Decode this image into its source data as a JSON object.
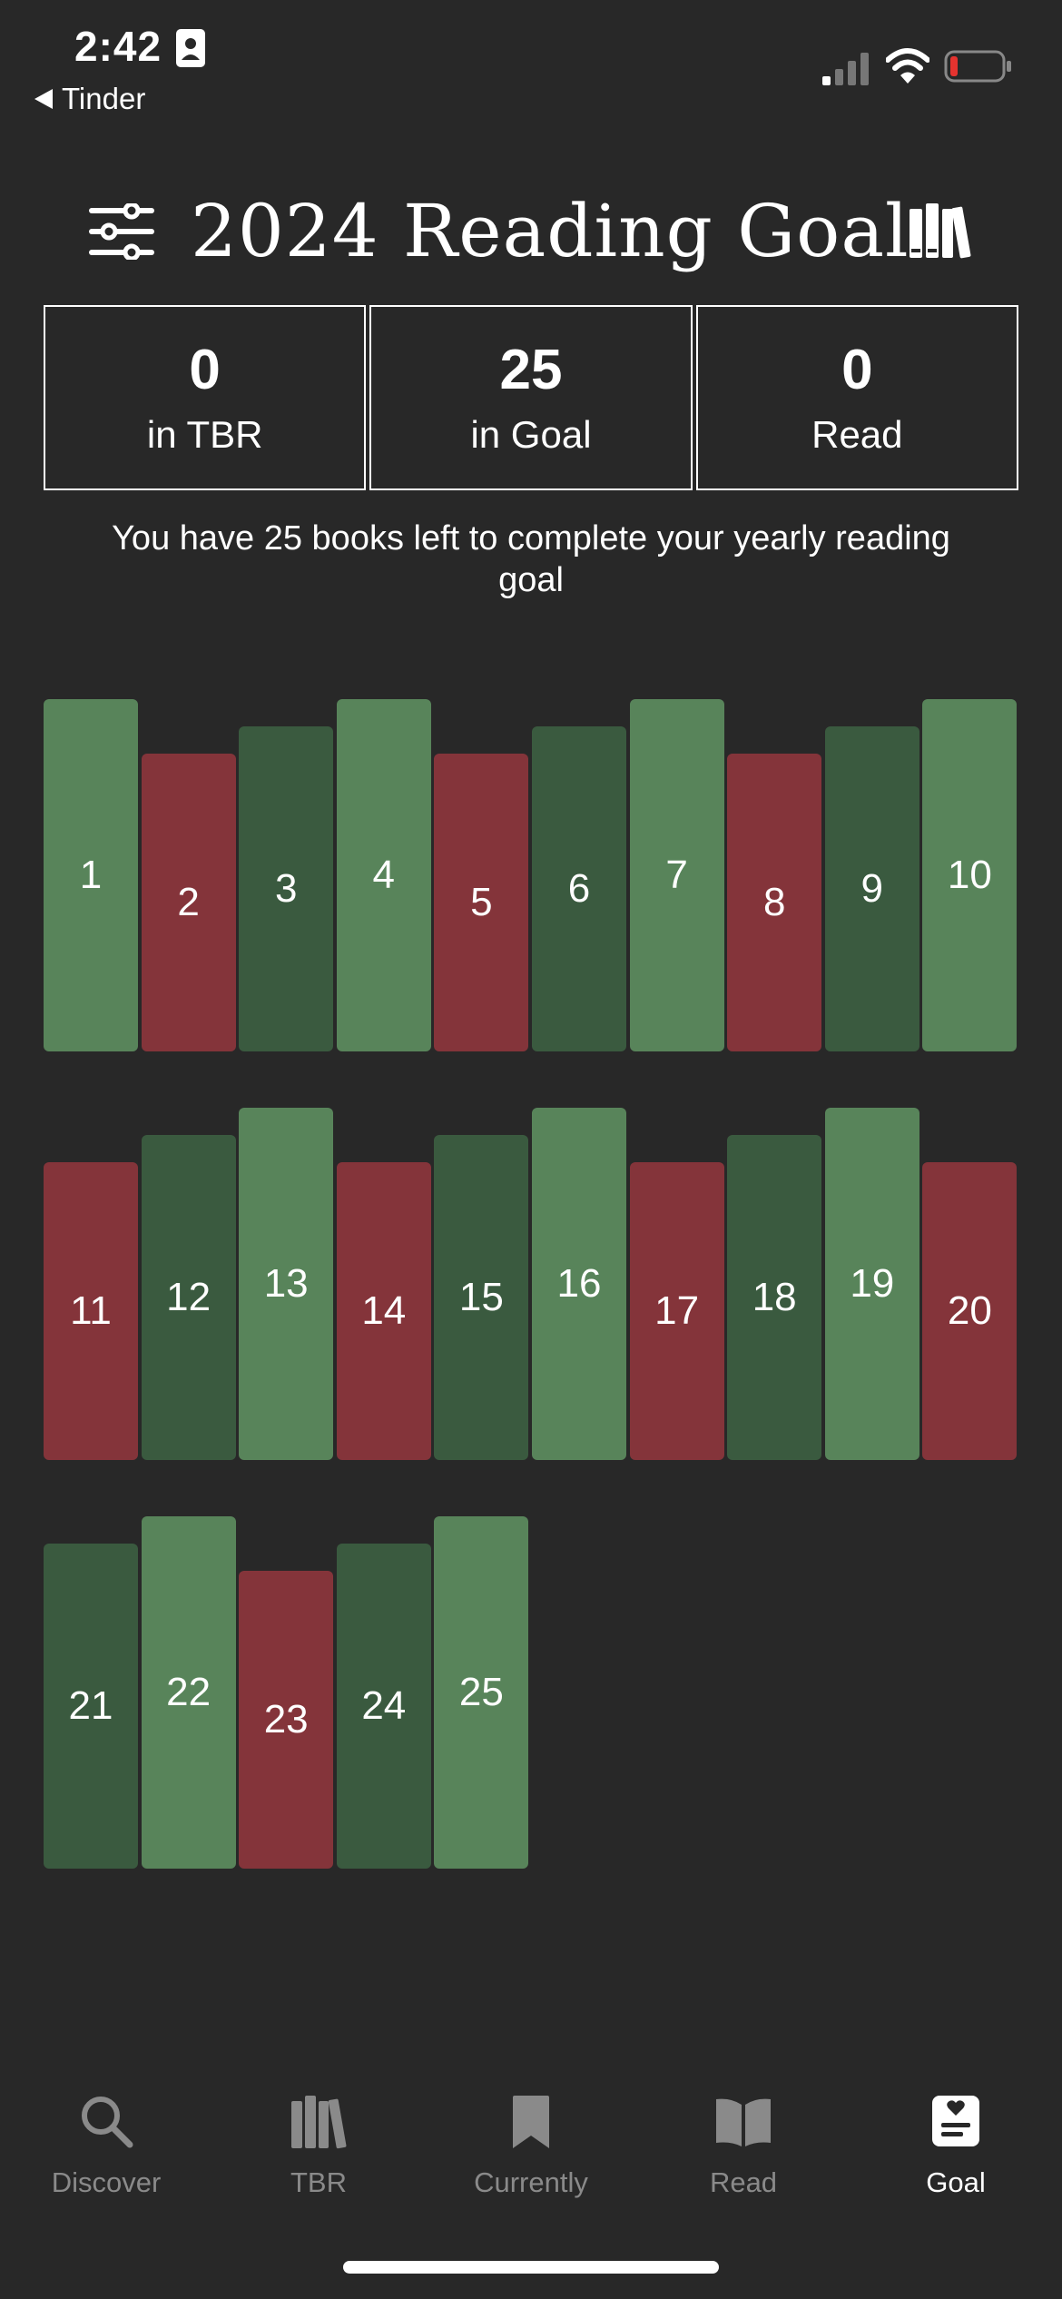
{
  "status_bar": {
    "time": "2:42",
    "back_app": "Tinder"
  },
  "header": {
    "title": "2024 Reading Goal"
  },
  "stats": [
    {
      "value": "0",
      "label": "in TBR"
    },
    {
      "value": "25",
      "label": "in Goal"
    },
    {
      "value": "0",
      "label": "Read"
    }
  ],
  "summary": "You have 25 books left to complete your yearly reading goal",
  "colors": {
    "light_green": "#58845a",
    "dark_green": "#3a5a3f",
    "red": "#84343a",
    "background": "#282828"
  },
  "books": [
    {
      "number": "1",
      "color": "light"
    },
    {
      "number": "2",
      "color": "red"
    },
    {
      "number": "3",
      "color": "dark"
    },
    {
      "number": "4",
      "color": "light"
    },
    {
      "number": "5",
      "color": "red"
    },
    {
      "number": "6",
      "color": "dark"
    },
    {
      "number": "7",
      "color": "light"
    },
    {
      "number": "8",
      "color": "red"
    },
    {
      "number": "9",
      "color": "dark"
    },
    {
      "number": "10",
      "color": "light"
    },
    {
      "number": "11",
      "color": "red"
    },
    {
      "number": "12",
      "color": "dark"
    },
    {
      "number": "13",
      "color": "light"
    },
    {
      "number": "14",
      "color": "red"
    },
    {
      "number": "15",
      "color": "dark"
    },
    {
      "number": "16",
      "color": "light"
    },
    {
      "number": "17",
      "color": "red"
    },
    {
      "number": "18",
      "color": "dark"
    },
    {
      "number": "19",
      "color": "light"
    },
    {
      "number": "20",
      "color": "red"
    },
    {
      "number": "21",
      "color": "dark"
    },
    {
      "number": "22",
      "color": "light"
    },
    {
      "number": "23",
      "color": "red"
    },
    {
      "number": "24",
      "color": "dark"
    },
    {
      "number": "25",
      "color": "light"
    }
  ],
  "tabs": [
    {
      "label": "Discover",
      "icon": "search-icon",
      "active": false
    },
    {
      "label": "TBR",
      "icon": "books-icon",
      "active": false
    },
    {
      "label": "Currently",
      "icon": "bookmark-icon",
      "active": false
    },
    {
      "label": "Read",
      "icon": "open-book-icon",
      "active": false
    },
    {
      "label": "Goal",
      "icon": "goal-note-icon",
      "active": true
    }
  ]
}
